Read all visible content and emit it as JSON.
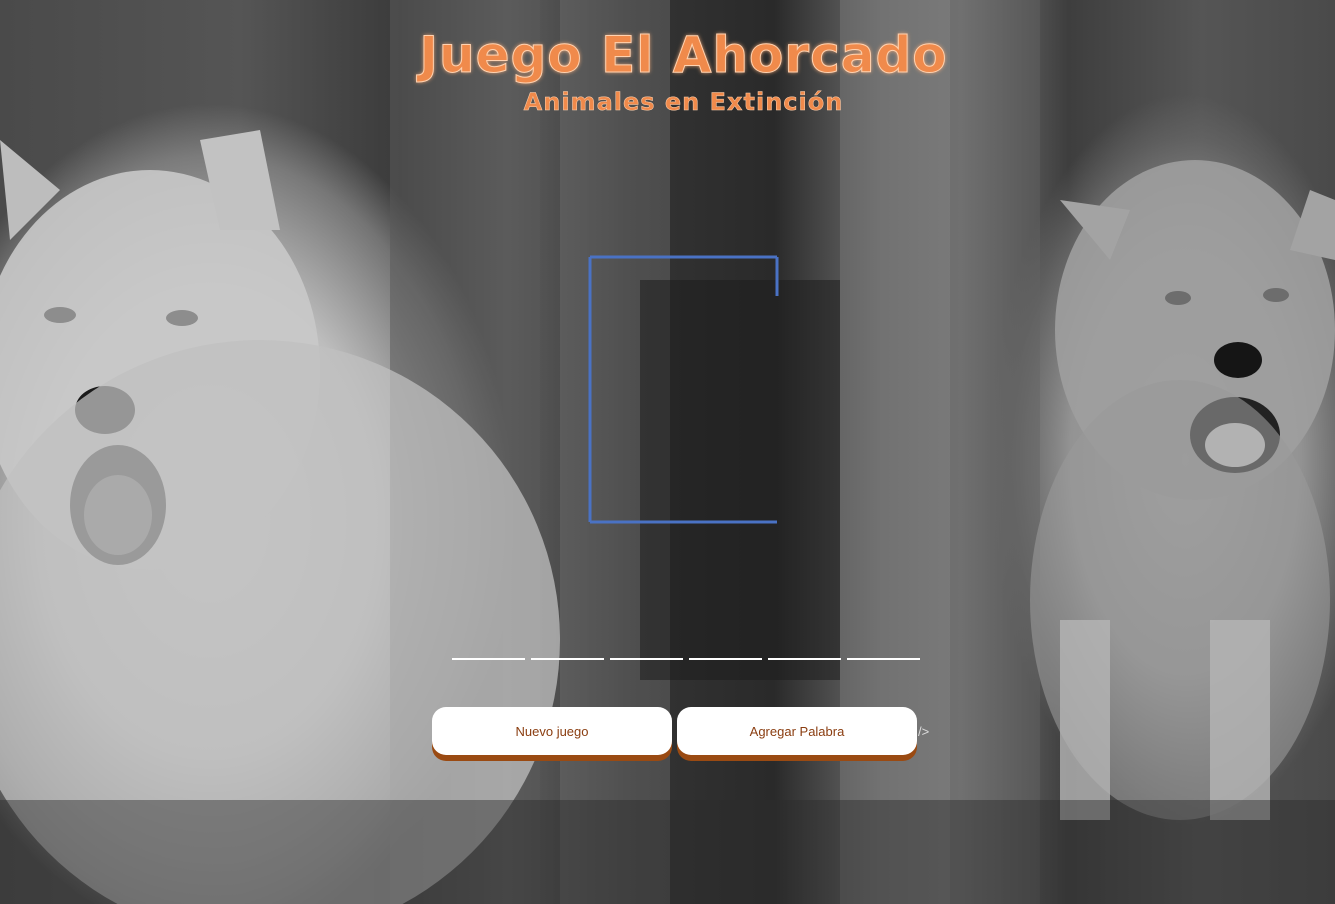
{
  "header": {
    "title": "Juego El Ahorcado",
    "subtitle": "Animales en Extinción"
  },
  "game": {
    "word_length": 6,
    "guessed_letters": [
      "",
      "",
      "",
      "",
      "",
      ""
    ],
    "gallows_color": "#4a72c4"
  },
  "controls": {
    "new_game_label": "Nuevo juego",
    "add_word_label": "Agregar Palabra",
    "stray_text": "/>"
  },
  "colors": {
    "title": "#f08a4b",
    "button_text": "#8a3d10",
    "button_shadow": "#9a4a12"
  }
}
